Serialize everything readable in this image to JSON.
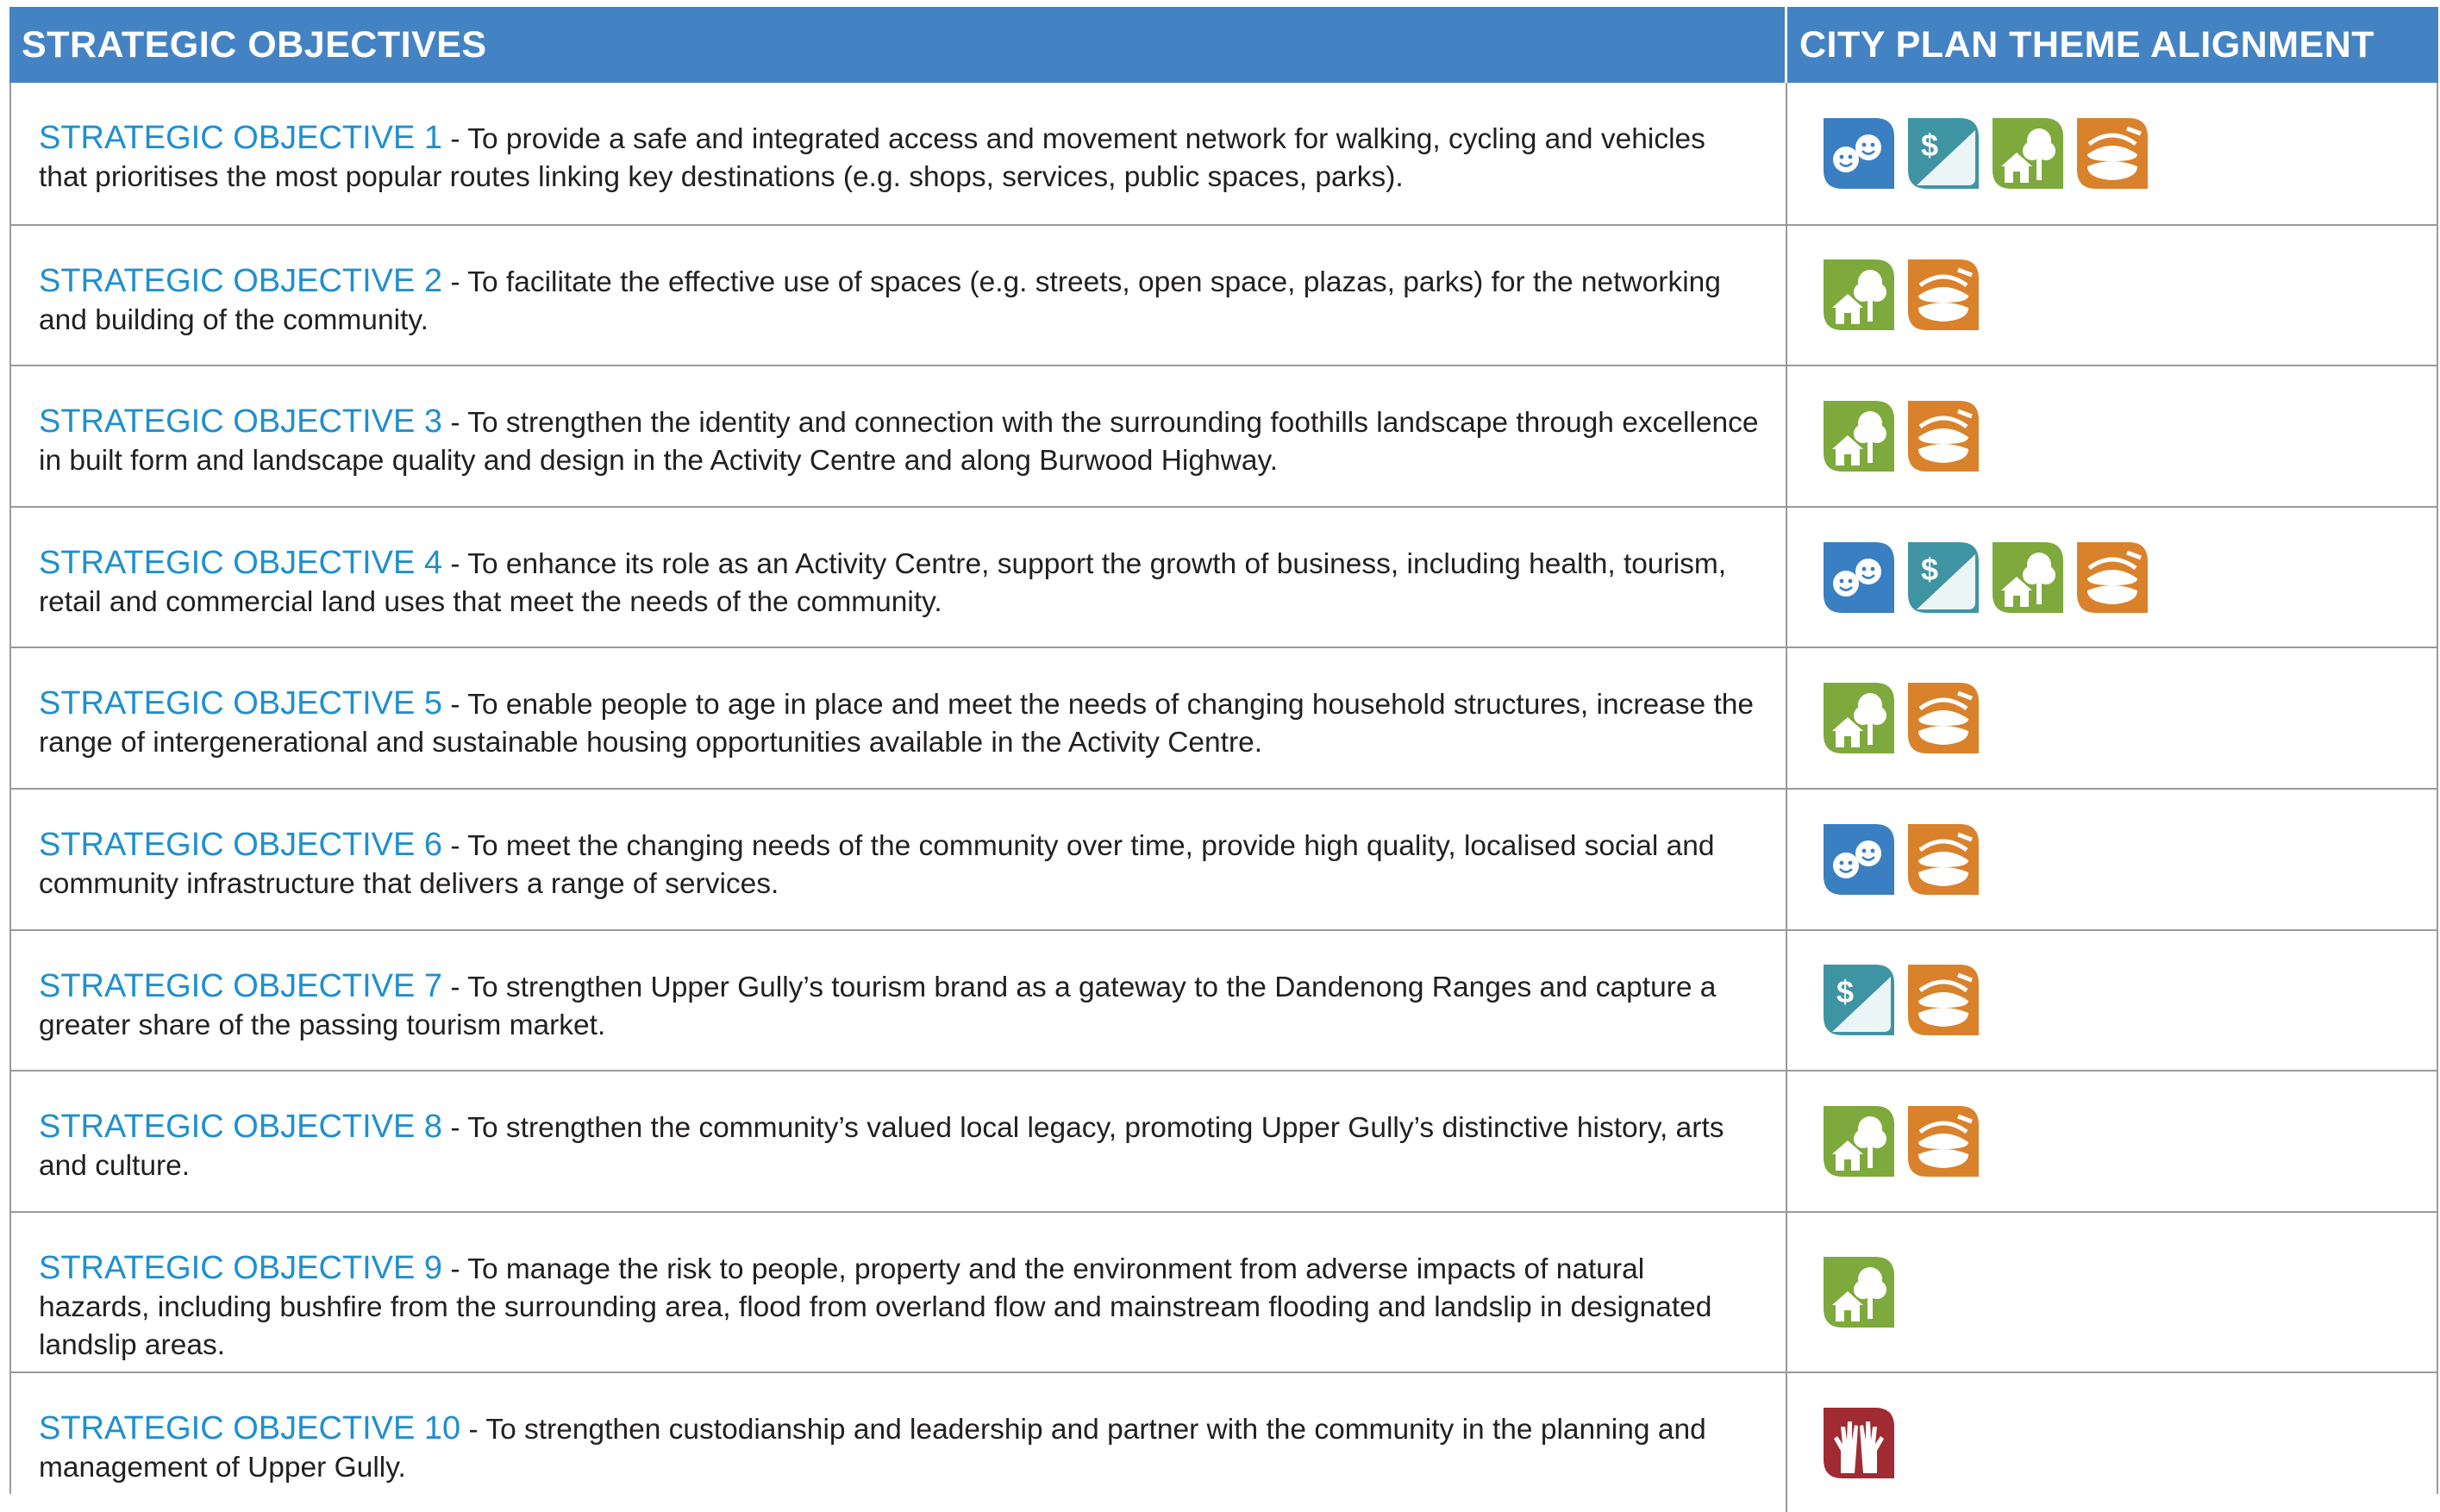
{
  "header": {
    "col1": "STRATEGIC OBJECTIVES",
    "col2": "CITY PLAN THEME ALIGNMENT"
  },
  "theme_colors": {
    "people": "#3a7fc1",
    "economy": "#3f94a3",
    "place": "#7ea93c",
    "leadership_community": "#d9822b",
    "leadership": "#a02b32"
  },
  "rows": [
    {
      "label": "STRATEGIC OBJECTIVE 1",
      "text": " - To provide a safe and integrated access and movement network for walking, cycling and vehicles that prioritises the most popular routes linking key destinations (e.g. shops, services, public spaces, parks).",
      "icons": [
        "people-icon",
        "economy-icon",
        "place-icon",
        "community-icon"
      ]
    },
    {
      "label": "STRATEGIC OBJECTIVE 2",
      "text": " - To facilitate the effective use of spaces (e.g. streets, open space, plazas, parks) for the networking and building of the community.",
      "icons": [
        "place-icon",
        "community-icon"
      ]
    },
    {
      "label": "STRATEGIC OBJECTIVE 3",
      "text": " - To strengthen the identity and connection with the surrounding foothills landscape through excellence in built form and landscape quality and design in the Activity Centre and along Burwood Highway.",
      "icons": [
        "place-icon",
        "community-icon"
      ]
    },
    {
      "label": "STRATEGIC OBJECTIVE 4",
      "text": " - To enhance its role as an Activity Centre, support the growth of business, including health, tourism, retail and commercial land uses that meet the needs of the community.",
      "icons": [
        "people-icon",
        "economy-icon",
        "place-icon",
        "community-icon"
      ]
    },
    {
      "label": "STRATEGIC OBJECTIVE 5",
      "text": " - To enable people to age in place and meet the needs of changing household structures, increase the range of intergenerational and sustainable housing opportunities available in the Activity Centre.",
      "icons": [
        "place-icon",
        "community-icon"
      ]
    },
    {
      "label": "STRATEGIC OBJECTIVE 6",
      "text": " - To meet the changing needs of the community over time, provide high quality, localised social and community infrastructure that delivers a range of services.",
      "icons": [
        "people-icon",
        "community-icon"
      ]
    },
    {
      "label": "STRATEGIC OBJECTIVE 7",
      "text": " - To strengthen Upper Gully’s tourism brand as a gateway to the Dandenong Ranges and capture a greater share of the passing tourism market.",
      "icons": [
        "economy-icon",
        "community-icon"
      ]
    },
    {
      "label": "STRATEGIC OBJECTIVE 8",
      "text": " - To strengthen the community’s valued local legacy, promoting Upper Gully’s distinctive history, arts and culture.",
      "icons": [
        "place-icon",
        "community-icon"
      ]
    },
    {
      "label": "STRATEGIC OBJECTIVE 9",
      "text": " - To manage the risk to people, property and the environment from adverse impacts of natural hazards, including bushfire from the surrounding area, flood from overland flow and mainstream flooding and landslip in designated landslip areas.",
      "icons": [
        "place-icon"
      ]
    },
    {
      "label": "STRATEGIC OBJECTIVE 10",
      "text": " - To strengthen custodianship and leadership and partner with the community in the planning and management of Upper Gully.",
      "icons": [
        "leadership-icon"
      ]
    }
  ]
}
